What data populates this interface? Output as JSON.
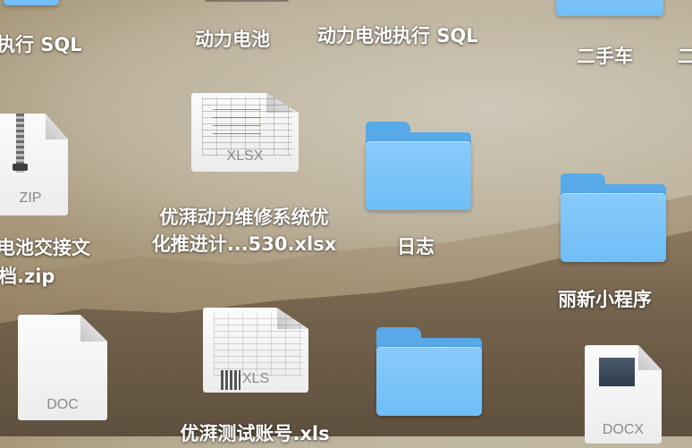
{
  "desktop": {
    "items": [
      {
        "id": "tl_text",
        "label": "执行 SQL"
      },
      {
        "id": "dongli",
        "label": "动力电池"
      },
      {
        "id": "dongli_sql",
        "label": "动力电池执行 SQL"
      },
      {
        "id": "ershouche",
        "label": "二手车"
      },
      {
        "id": "edge_r",
        "label": "二"
      },
      {
        "id": "zip_file",
        "ext": "ZIP",
        "line1": "电池交接文",
        "line2": "档.zip"
      },
      {
        "id": "xlsx_file",
        "ext": "XLSX",
        "line1": "优湃动力维修系统优",
        "line2": "化推进计...530.xlsx"
      },
      {
        "id": "rizhi",
        "label": "日志"
      },
      {
        "id": "lixin",
        "label": "丽新小程序"
      },
      {
        "id": "doc_file",
        "ext": "DOC"
      },
      {
        "id": "xls_file",
        "ext": "XLS",
        "line1": "优湃测试账号.xls"
      },
      {
        "id": "docx_file",
        "ext": "DOCX"
      }
    ]
  },
  "colors": {
    "folder_front": "#7cc4f8",
    "folder_back": "#57a9e8",
    "label_text": "#ffffff"
  }
}
